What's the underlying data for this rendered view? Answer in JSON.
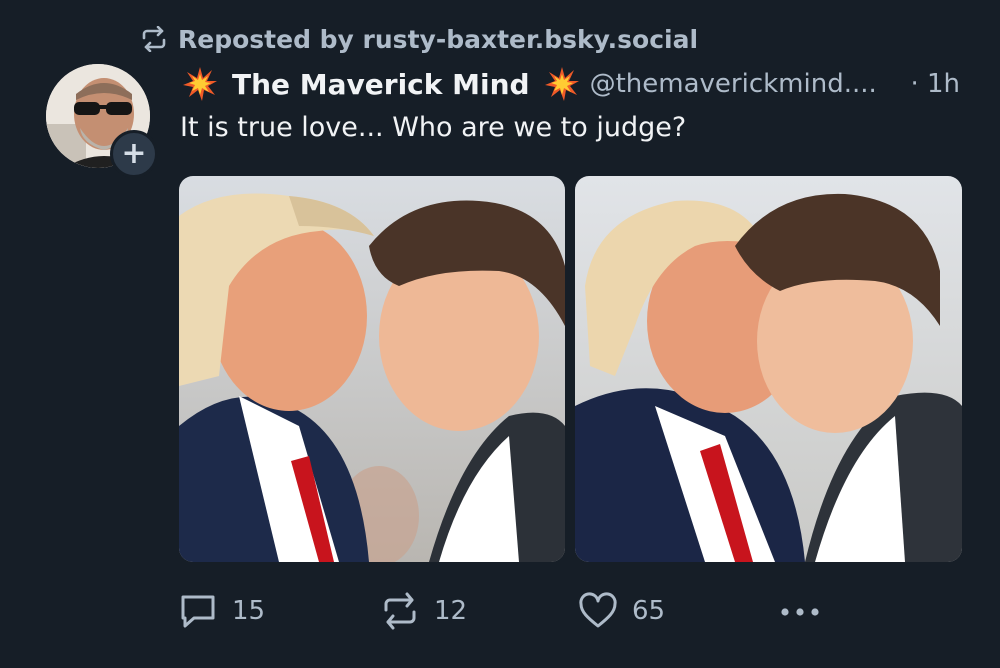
{
  "repost": {
    "label": "Reposted by rusty-baxter.bsky.social",
    "icon": "repost-icon"
  },
  "author": {
    "display_name": "The Maverick Mind",
    "handle": "@themaverickmind....",
    "emoji": "collision-emoji",
    "avatar": "avatar",
    "follow_icon": "plus-icon"
  },
  "meta": {
    "time": "· 1h"
  },
  "post": {
    "text": "It is true love... Who are we to judge?"
  },
  "media": {
    "count": 2
  },
  "actions": {
    "replies": "15",
    "reposts": "12",
    "likes": "65",
    "reply_icon": "reply-icon",
    "repost_icon": "repost-icon",
    "like_icon": "heart-icon",
    "more_icon": "more-dots-icon"
  },
  "colors": {
    "background": "#161e27",
    "text_primary": "#f1f3f5",
    "text_secondary": "#aebbc9",
    "badge_bg": "#2d3a49"
  }
}
